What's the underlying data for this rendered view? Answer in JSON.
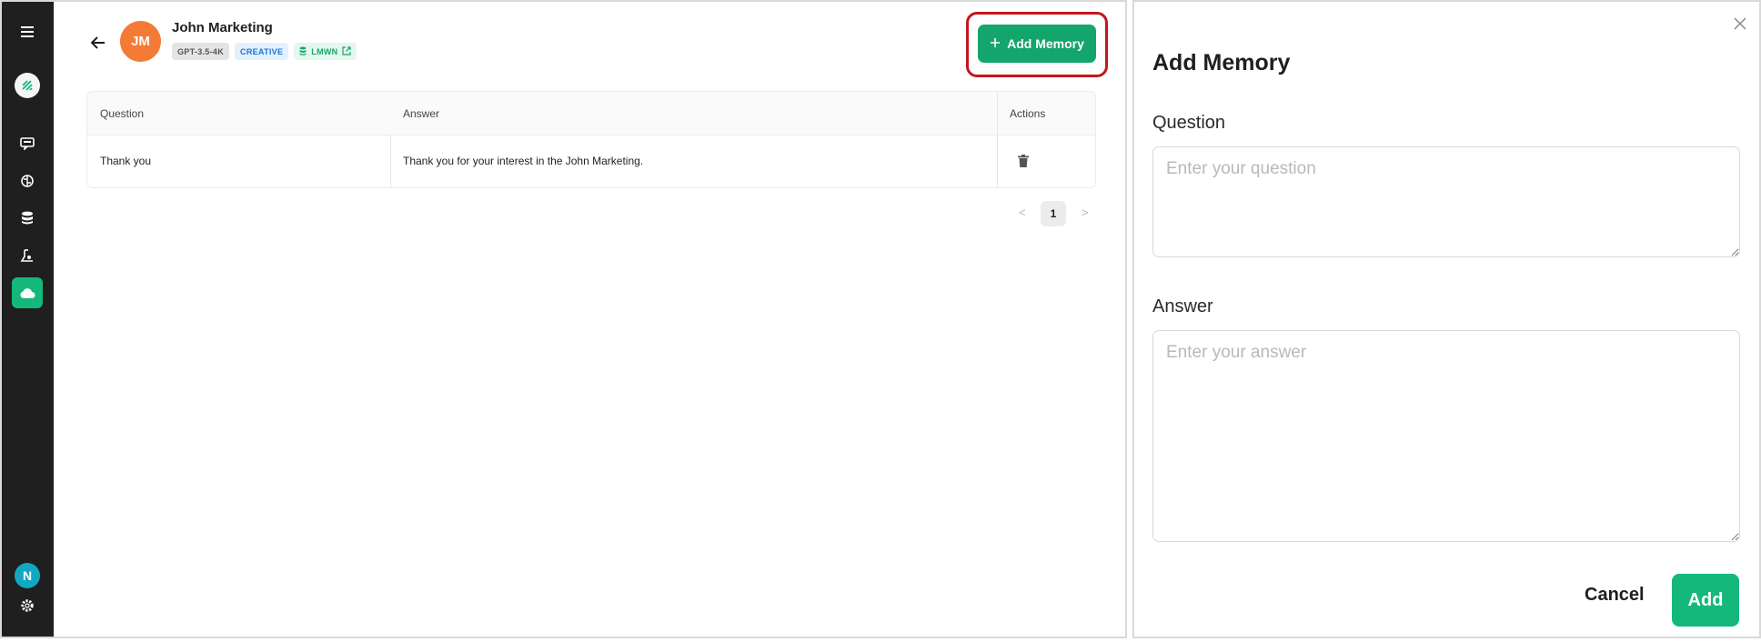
{
  "sidebar": {
    "icons": [
      "menu-icon",
      "logo-icon",
      "chat-icon",
      "brain-icon",
      "database-icon",
      "lab-icon",
      "cloud-icon"
    ],
    "user_initial": "N",
    "settings_icon": "gear-icon",
    "active_color": "#14b87a"
  },
  "header": {
    "avatar_initials": "JM",
    "agent_name": "John Marketing",
    "tags": {
      "model": "GPT-3.5-4K",
      "mode": "CREATIVE",
      "knowledge": "LMWN"
    },
    "add_memory_label": "Add Memory",
    "accent_color": "#14a56c",
    "highlight_color": "#c4161c"
  },
  "table": {
    "columns": [
      "Question",
      "Answer",
      "Actions"
    ],
    "rows": [
      {
        "question": "Thank you",
        "answer": "Thank you for your interest in the John Marketing.",
        "action_icon": "trash-icon"
      }
    ]
  },
  "pagination": {
    "prev": "<",
    "current": "1",
    "next": ">"
  },
  "drawer": {
    "title": "Add Memory",
    "question_label": "Question",
    "question_placeholder": "Enter your question",
    "answer_label": "Answer",
    "answer_placeholder": "Enter your answer",
    "cancel_label": "Cancel",
    "add_label": "Add"
  }
}
